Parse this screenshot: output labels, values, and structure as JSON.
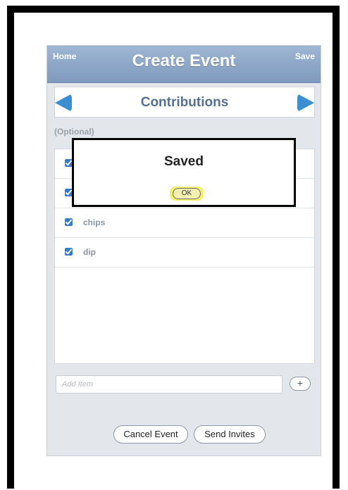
{
  "navbar": {
    "title": "Create Event",
    "left_label": "Home",
    "right_label": "Save"
  },
  "section": {
    "title": "Contributions"
  },
  "optional_label": "(Optional)",
  "items": [
    {
      "label": "",
      "checked": true
    },
    {
      "label": "",
      "checked": true
    },
    {
      "label": "chips",
      "checked": true
    },
    {
      "label": "dip",
      "checked": true
    }
  ],
  "add_item": {
    "placeholder": "Add Item",
    "add_label": "+"
  },
  "buttons": {
    "cancel": "Cancel Event",
    "send": "Send Invites"
  },
  "dialog": {
    "title": "Saved",
    "ok_label": "OK"
  },
  "colors": {
    "navbar": "#8da7c8",
    "accent_arrow": "#3b8fd0",
    "highlight": "#f5f06b"
  }
}
